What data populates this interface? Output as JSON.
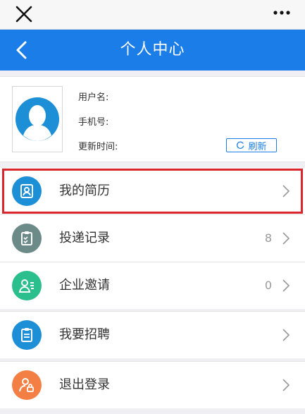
{
  "header": {
    "title": "个人中心"
  },
  "profile": {
    "username_label": "用户名:",
    "phone_label": "手机号:",
    "updated_label": "更新时间:",
    "refresh_label": "刷新"
  },
  "menu": {
    "resume": {
      "label": "我的简历",
      "color": "#1c8fd6"
    },
    "delivery": {
      "label": "投递记录",
      "count": "8",
      "color": "#6b8a88"
    },
    "invites": {
      "label": "企业邀请",
      "count": "0",
      "color": "#2bbf8e"
    },
    "recruit": {
      "label": "我要招聘",
      "color": "#1c8fd6"
    },
    "logout": {
      "label": "退出登录",
      "color": "#f37f45"
    }
  },
  "colors": {
    "primary": "#1a7de8",
    "highlight": "#d9262c"
  }
}
